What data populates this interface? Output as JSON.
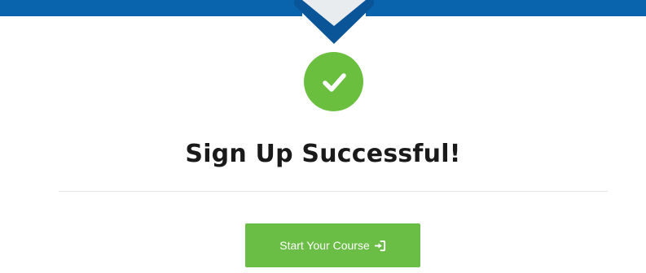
{
  "header": {
    "icon": "down-pointer-notch",
    "colors": {
      "band": "#0a63ad",
      "band_dark": "#0a5598",
      "notch": "#e9ecef"
    }
  },
  "status": {
    "icon": "check-circle-icon",
    "color": "#6bbf3f"
  },
  "title": "Sign Up Successful!",
  "cta": {
    "label": "Start Your Course",
    "icon": "sign-in-icon",
    "color": "#6abd45"
  }
}
